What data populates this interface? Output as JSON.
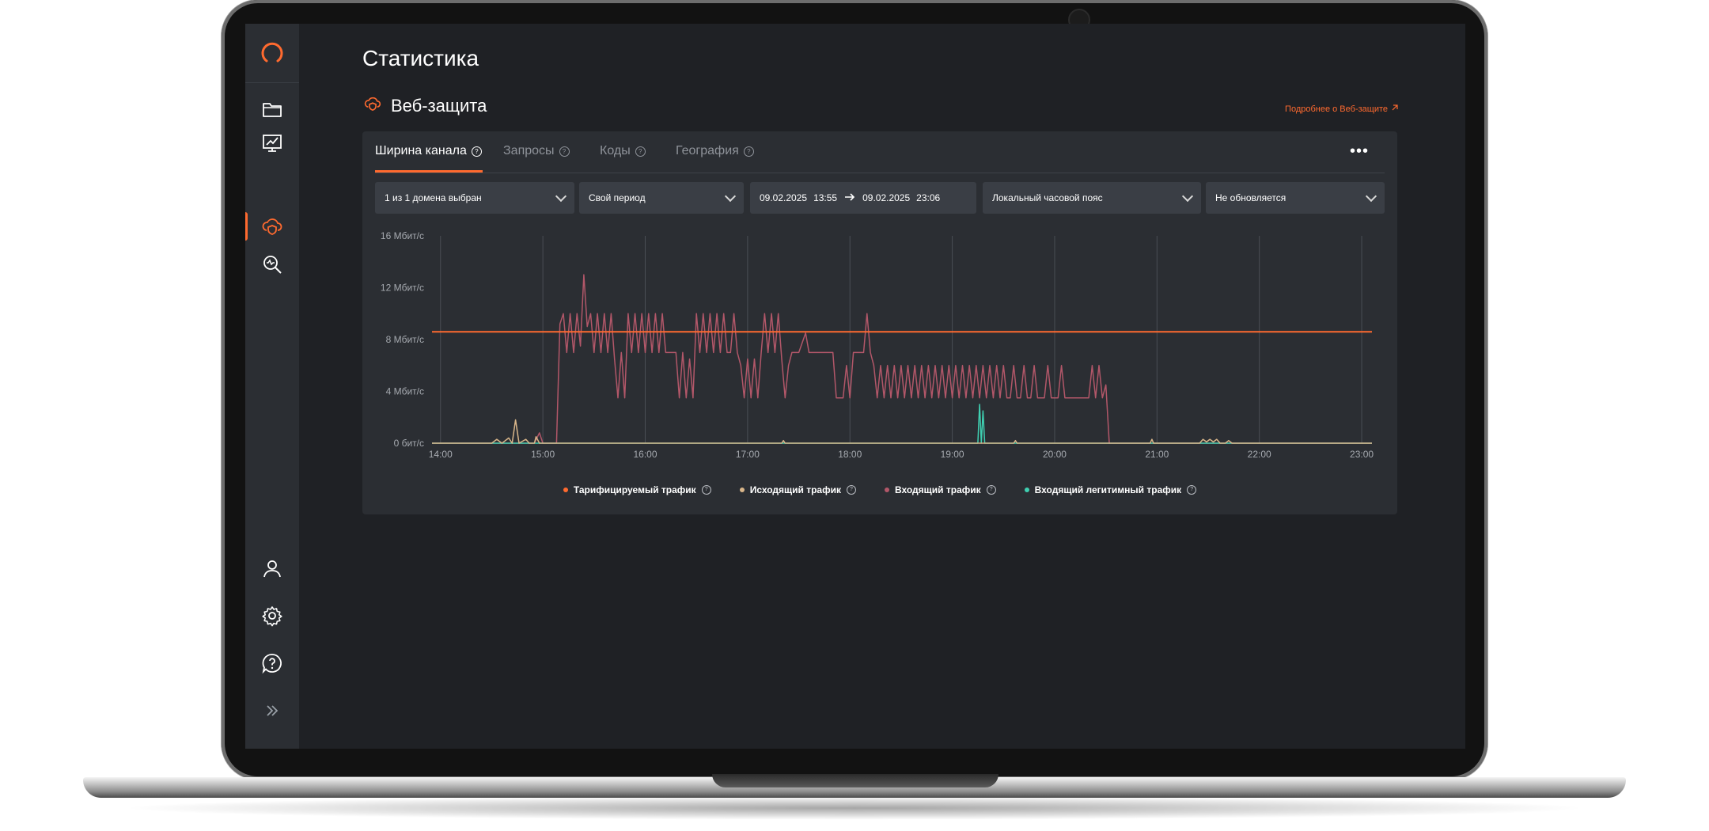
{
  "page": {
    "title": "Статистика"
  },
  "section": {
    "title": "Веб-защита",
    "more_link": "Подробнее о Веб-защите"
  },
  "sidebar": {
    "items": [
      "logo",
      "folder-icon",
      "monitor-chart-icon",
      "cloud-shield-icon",
      "search-analytics-icon",
      "user-icon",
      "gear-icon",
      "help-icon",
      "expand-icon"
    ],
    "active": "cloud-shield-icon"
  },
  "tabs": [
    {
      "label": "Ширина канала",
      "active": true
    },
    {
      "label": "Запросы",
      "active": false
    },
    {
      "label": "Коды",
      "active": false
    },
    {
      "label": "География",
      "active": false
    }
  ],
  "filters": {
    "domains": "1 из 1 домена выбран",
    "period": "Свой период",
    "date_from": "09.02.2025",
    "time_from": "13:55",
    "date_to": "09.02.2025",
    "time_to": "23:06",
    "timezone": "Локальный часовой пояс",
    "refresh": "Не обновляется"
  },
  "legend": [
    {
      "label": "Тарифицируемый трафик",
      "color": "#ff6a2f"
    },
    {
      "label": "Исходящий трафик",
      "color": "#d9b68a"
    },
    {
      "label": "Входящий трафик",
      "color": "#b25769"
    },
    {
      "label": "Входящий легитимный трафик",
      "color": "#3fcfb1"
    }
  ],
  "colors": {
    "accent": "#ff6a2f",
    "grid": "#4a4e55",
    "text_muted": "#8f939a"
  },
  "chart_data": {
    "type": "line",
    "x_ticks": [
      "14:00",
      "15:00",
      "16:00",
      "17:00",
      "18:00",
      "19:00",
      "20:00",
      "21:00",
      "22:00",
      "23:00"
    ],
    "y_ticks": [
      "0 бит/с",
      "4 Мбит/с",
      "8 Мбит/с",
      "12 Мбит/с",
      "16 Мбит/с"
    ],
    "ylim": [
      0,
      16
    ],
    "xlim": [
      "13:55",
      "23:06"
    ],
    "unit": "Мбит/с",
    "series": [
      {
        "name": "Тарифицируемый трафик",
        "color": "#ff6a2f",
        "points": [
          [
            "13:55",
            8.6
          ],
          [
            "23:06",
            8.6
          ]
        ]
      },
      {
        "name": "Входящий трафик",
        "color": "#b25769",
        "points": [
          [
            "13:55",
            0
          ],
          [
            "14:55",
            0
          ],
          [
            "14:58",
            0.8
          ],
          [
            "15:00",
            0
          ],
          [
            "15:08",
            0
          ],
          [
            "15:10",
            9.2
          ],
          [
            "15:12",
            10
          ],
          [
            "15:14",
            7
          ],
          [
            "15:16",
            10
          ],
          [
            "15:18",
            7
          ],
          [
            "15:20",
            10
          ],
          [
            "15:22",
            7.5
          ],
          [
            "15:24",
            13
          ],
          [
            "15:26",
            9
          ],
          [
            "15:28",
            10
          ],
          [
            "15:30",
            7
          ],
          [
            "15:32",
            10
          ],
          [
            "15:34",
            7
          ],
          [
            "15:36",
            10
          ],
          [
            "15:38",
            7
          ],
          [
            "15:40",
            10
          ],
          [
            "15:42",
            6.5
          ],
          [
            "15:44",
            3.5
          ],
          [
            "15:46",
            7
          ],
          [
            "15:48",
            3.5
          ],
          [
            "15:50",
            10
          ],
          [
            "15:52",
            7
          ],
          [
            "15:54",
            10
          ],
          [
            "15:56",
            7
          ],
          [
            "15:58",
            10
          ],
          [
            "16:00",
            7
          ],
          [
            "16:02",
            10
          ],
          [
            "16:04",
            7
          ],
          [
            "16:06",
            10
          ],
          [
            "16:08",
            7
          ],
          [
            "16:10",
            10
          ],
          [
            "16:12",
            7
          ],
          [
            "16:15",
            7
          ],
          [
            "16:18",
            7
          ],
          [
            "16:20",
            3.5
          ],
          [
            "16:22",
            7
          ],
          [
            "16:24",
            3.5
          ],
          [
            "16:26",
            6.5
          ],
          [
            "16:28",
            3.5
          ],
          [
            "16:30",
            10
          ],
          [
            "16:32",
            7
          ],
          [
            "16:34",
            10
          ],
          [
            "16:36",
            7
          ],
          [
            "16:38",
            10
          ],
          [
            "16:40",
            7
          ],
          [
            "16:42",
            10
          ],
          [
            "16:44",
            7
          ],
          [
            "16:46",
            10
          ],
          [
            "16:48",
            7
          ],
          [
            "16:50",
            7
          ],
          [
            "16:52",
            10
          ],
          [
            "16:54",
            7
          ],
          [
            "16:56",
            6
          ],
          [
            "16:58",
            3.5
          ],
          [
            "17:00",
            6.5
          ],
          [
            "17:02",
            3.5
          ],
          [
            "17:04",
            6.5
          ],
          [
            "17:06",
            3.5
          ],
          [
            "17:08",
            7
          ],
          [
            "17:10",
            10
          ],
          [
            "17:12",
            7
          ],
          [
            "17:14",
            10
          ],
          [
            "17:16",
            7
          ],
          [
            "17:18",
            10
          ],
          [
            "17:20",
            6.5
          ],
          [
            "17:22",
            3.5
          ],
          [
            "17:24",
            6
          ],
          [
            "17:26",
            7
          ],
          [
            "17:30",
            7
          ],
          [
            "17:34",
            8.5
          ],
          [
            "17:36",
            7
          ],
          [
            "17:40",
            7
          ],
          [
            "17:50",
            7
          ],
          [
            "17:52",
            3.5
          ],
          [
            "17:56",
            3.5
          ],
          [
            "17:58",
            6
          ],
          [
            "18:00",
            3.5
          ],
          [
            "18:02",
            7
          ],
          [
            "18:06",
            7
          ],
          [
            "18:08",
            7
          ],
          [
            "18:10",
            10
          ],
          [
            "18:12",
            7
          ],
          [
            "18:14",
            6
          ],
          [
            "18:16",
            3.5
          ],
          [
            "18:18",
            6
          ],
          [
            "18:20",
            3.5
          ],
          [
            "18:22",
            6
          ],
          [
            "18:24",
            3.5
          ],
          [
            "18:26",
            6
          ],
          [
            "18:28",
            3.5
          ],
          [
            "18:30",
            6
          ],
          [
            "18:32",
            3.5
          ],
          [
            "18:34",
            6
          ],
          [
            "18:36",
            3.5
          ],
          [
            "18:38",
            6
          ],
          [
            "18:40",
            3.5
          ],
          [
            "18:42",
            6
          ],
          [
            "18:44",
            3.5
          ],
          [
            "18:46",
            6
          ],
          [
            "18:48",
            3.5
          ],
          [
            "18:50",
            6
          ],
          [
            "18:52",
            3.5
          ],
          [
            "18:54",
            6
          ],
          [
            "18:56",
            3.5
          ],
          [
            "18:58",
            6
          ],
          [
            "19:00",
            3.5
          ],
          [
            "19:02",
            6
          ],
          [
            "19:04",
            3.5
          ],
          [
            "19:06",
            6
          ],
          [
            "19:08",
            3.5
          ],
          [
            "19:10",
            6
          ],
          [
            "19:12",
            3.5
          ],
          [
            "19:14",
            6
          ],
          [
            "19:16",
            3.5
          ],
          [
            "19:18",
            6
          ],
          [
            "19:20",
            3.5
          ],
          [
            "19:22",
            6
          ],
          [
            "19:24",
            3.5
          ],
          [
            "19:26",
            6
          ],
          [
            "19:28",
            3.5
          ],
          [
            "19:30",
            6
          ],
          [
            "19:32",
            3.5
          ],
          [
            "19:34",
            3.5
          ],
          [
            "19:36",
            6
          ],
          [
            "19:38",
            3.5
          ],
          [
            "19:40",
            3.5
          ],
          [
            "19:42",
            6
          ],
          [
            "19:44",
            3.5
          ],
          [
            "19:46",
            3.5
          ],
          [
            "19:48",
            6
          ],
          [
            "19:50",
            3.5
          ],
          [
            "19:52",
            3.5
          ],
          [
            "19:54",
            3.5
          ],
          [
            "19:56",
            6
          ],
          [
            "19:58",
            3.5
          ],
          [
            "20:00",
            3.5
          ],
          [
            "20:02",
            3.5
          ],
          [
            "20:04",
            6
          ],
          [
            "20:06",
            3.5
          ],
          [
            "20:08",
            3.5
          ],
          [
            "20:10",
            3.5
          ],
          [
            "20:15",
            3.5
          ],
          [
            "20:20",
            3.5
          ],
          [
            "20:22",
            6
          ],
          [
            "20:24",
            3.5
          ],
          [
            "20:26",
            6
          ],
          [
            "20:28",
            3.5
          ],
          [
            "20:30",
            4.5
          ],
          [
            "20:32",
            0
          ],
          [
            "23:06",
            0
          ]
        ]
      },
      {
        "name": "Исходящий трафик",
        "color": "#d9b68a",
        "points": [
          [
            "13:55",
            0
          ],
          [
            "14:30",
            0
          ],
          [
            "14:33",
            0.3
          ],
          [
            "14:36",
            0
          ],
          [
            "14:40",
            0.4
          ],
          [
            "14:42",
            0
          ],
          [
            "14:44",
            1.8
          ],
          [
            "14:46",
            0
          ],
          [
            "14:50",
            0.3
          ],
          [
            "14:52",
            0
          ],
          [
            "14:55",
            0
          ],
          [
            "14:56",
            0.5
          ],
          [
            "14:58",
            0
          ],
          [
            "15:00",
            0
          ],
          [
            "17:20",
            0
          ],
          [
            "17:21",
            0.2
          ],
          [
            "17:22",
            0
          ],
          [
            "19:36",
            0
          ],
          [
            "19:37",
            0.2
          ],
          [
            "19:38",
            0
          ],
          [
            "20:56",
            0
          ],
          [
            "20:57",
            0.3
          ],
          [
            "20:58",
            0
          ],
          [
            "21:25",
            0
          ],
          [
            "21:27",
            0.3
          ],
          [
            "21:29",
            0.1
          ],
          [
            "21:31",
            0.3
          ],
          [
            "21:33",
            0.1
          ],
          [
            "21:35",
            0.3
          ],
          [
            "21:37",
            0
          ],
          [
            "21:40",
            0
          ],
          [
            "21:42",
            0.2
          ],
          [
            "21:44",
            0
          ],
          [
            "23:06",
            0
          ]
        ]
      },
      {
        "name": "Входящий легитимный трафик",
        "color": "#3fcfb1",
        "points": [
          [
            "13:55",
            0
          ],
          [
            "19:15",
            0
          ],
          [
            "19:16",
            3
          ],
          [
            "19:17",
            0
          ],
          [
            "19:18",
            2.5
          ],
          [
            "19:19",
            0
          ],
          [
            "23:06",
            0
          ]
        ]
      }
    ]
  }
}
